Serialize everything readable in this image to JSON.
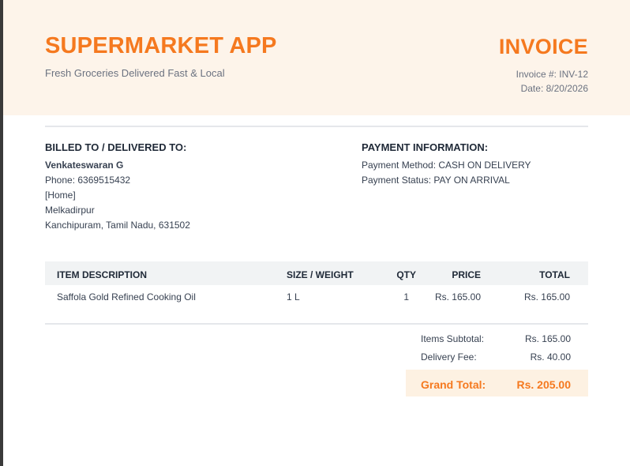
{
  "header": {
    "brand": "SUPERMARKET APP",
    "tagline": "Fresh Groceries Delivered Fast & Local",
    "doc_title": "INVOICE",
    "invoice_number": "Invoice #: INV-12",
    "date": "Date: 8/20/2026"
  },
  "billed_to": {
    "title": "BILLED TO / DELIVERED TO:",
    "name": "Venkateswaran G",
    "phone": "Phone: 6369515432",
    "address_type": "[Home]",
    "locality": "Melkadirpur",
    "city_line": "Kanchipuram, Tamil Nadu, 631502"
  },
  "payment": {
    "title": "PAYMENT INFORMATION:",
    "method": "Payment Method: CASH ON DELIVERY",
    "status": "Payment Status: PAY ON ARRIVAL"
  },
  "table": {
    "headers": {
      "description": "ITEM DESCRIPTION",
      "size": "SIZE / WEIGHT",
      "qty": "QTY",
      "price": "PRICE",
      "total": "TOTAL"
    },
    "rows": [
      {
        "description": "Saffola Gold Refined Cooking Oil",
        "size": "1 L",
        "qty": "1",
        "price": "Rs. 165.00",
        "total": "Rs. 165.00"
      }
    ]
  },
  "summary": {
    "subtotal_label": "Items Subtotal:",
    "subtotal_value": "Rs. 165.00",
    "delivery_label": "Delivery Fee:",
    "delivery_value": "Rs. 40.00",
    "grand_label": "Grand Total:",
    "grand_value": "Rs. 205.00"
  },
  "colors": {
    "accent": "#f5791f",
    "header_bg": "#fdf4ea",
    "table_header_bg": "#f1f3f4"
  }
}
